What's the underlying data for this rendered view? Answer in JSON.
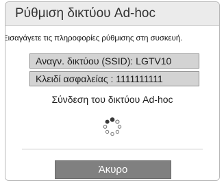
{
  "dialog": {
    "title": "Ρύθμιση δικτύου Ad-hoc",
    "instruction": "Εισαγάγετε τις πληροφορίες ρύθμισης στη συσκευή.",
    "ssid_line": "Αναγν. δικτύου (SSID): LGTV10",
    "key_line": "Κλειδί ασφαλείας : 1111111111",
    "status": "Σύνδεση του δικτύου Ad-hoc",
    "spinner_icon": "loading-spinner-icon",
    "cancel_label": "Άκυρο"
  },
  "colors": {
    "dialog_background": "#f4f4f4",
    "title_bar": "#ebebeb",
    "info_box": "#d3d3d3",
    "button": "#808080",
    "button_text": "#ffffff"
  }
}
